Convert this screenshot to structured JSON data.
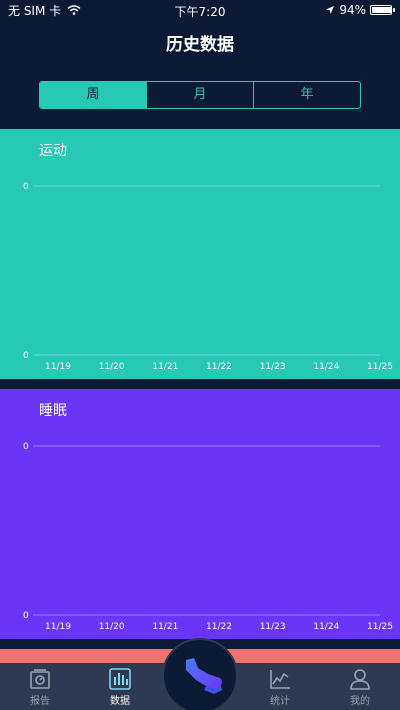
{
  "status_bar": {
    "carrier": "无 SIM 卡",
    "time": "下午7:20",
    "battery": "94%",
    "battery_level": 0.94
  },
  "page_title": "历史数据",
  "segments": [
    {
      "label": "周",
      "active": true
    },
    {
      "label": "月",
      "active": false
    },
    {
      "label": "年",
      "active": false
    }
  ],
  "chart_data": [
    {
      "type": "line",
      "title": "运动",
      "categories": [
        "11/19",
        "11/20",
        "11/21",
        "11/22",
        "11/23",
        "11/24",
        "11/25"
      ],
      "yticks": [
        "0",
        "0"
      ],
      "series": [],
      "background": "#27c8b4"
    },
    {
      "type": "line",
      "title": "睡眠",
      "categories": [
        "11/19",
        "11/20",
        "11/21",
        "11/22",
        "11/23",
        "11/24",
        "11/25"
      ],
      "yticks": [
        "0",
        "0"
      ],
      "series": [],
      "background": "#6a35f6"
    }
  ],
  "tabbar": {
    "items": [
      {
        "label": "报告",
        "icon": "report-icon",
        "active": false
      },
      {
        "label": "数据",
        "icon": "bar-chart-icon",
        "active": true
      },
      {
        "label": "",
        "icon": "shoe-icon",
        "active": false
      },
      {
        "label": "统计",
        "icon": "line-chart-icon",
        "active": false
      },
      {
        "label": "我的",
        "icon": "person-icon",
        "active": false
      }
    ]
  },
  "colors": {
    "background": "#0c1a36",
    "accent": "#27c8b4",
    "sleep": "#6a35f6",
    "tabbar": "#2d3a4f",
    "pink_strip": "#f07373"
  }
}
